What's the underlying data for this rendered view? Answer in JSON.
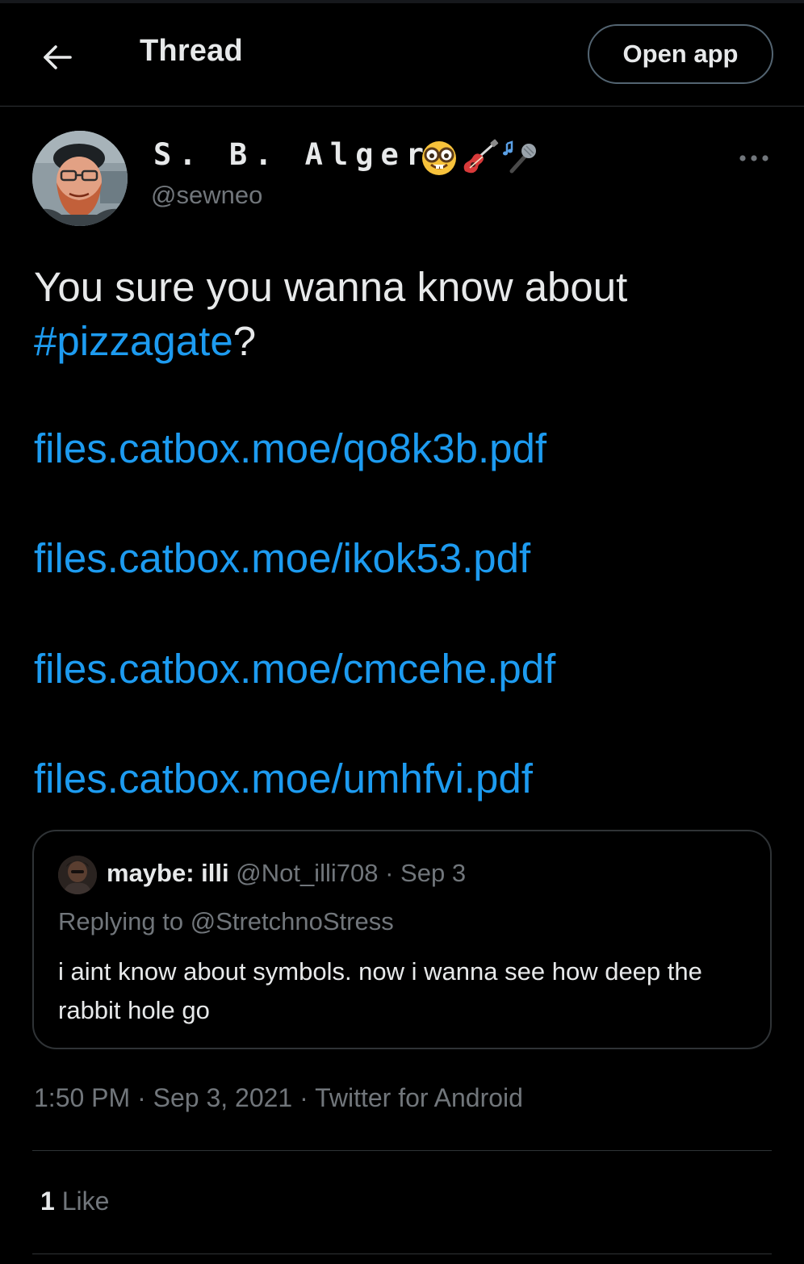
{
  "header": {
    "title": "Thread",
    "open_app_label": "Open app",
    "back_icon": "arrow-left-icon"
  },
  "tweet": {
    "author": {
      "display_name": "S. B. Alger",
      "name_emojis": [
        "nerd-face-emoji",
        "guitar-emoji",
        "microphone-emoji"
      ],
      "handle": "@sewneo"
    },
    "more_icon": "ellipsis-icon",
    "text_before": "You sure you wanna know about ",
    "hashtag": "#pizzagate",
    "text_after": "?",
    "links": [
      "files.catbox.moe/qo8k3b.pdf",
      "files.catbox.moe/ikok53.pdf",
      "files.catbox.moe/cmcehe.pdf",
      "files.catbox.moe/umhfvi.pdf"
    ],
    "quote": {
      "name": "maybe: illi",
      "handle": "@Not_illi708",
      "separator": "·",
      "date": "Sep 3",
      "replying_prefix": "Replying to ",
      "replying_to": "@StretchnoStress",
      "text": "i aint know about symbols. now i wanna see how deep the rabbit hole go"
    },
    "meta": {
      "time": "1:50 PM",
      "separator": "·",
      "date": "Sep 3, 2021",
      "source": "Twitter for Android"
    },
    "likes": {
      "count": "1",
      "label": "Like"
    }
  },
  "colors": {
    "background": "#000000",
    "text": "#e7e9ea",
    "secondary": "#71767b",
    "accent": "#1d9bf0",
    "border": "#2f3336"
  }
}
